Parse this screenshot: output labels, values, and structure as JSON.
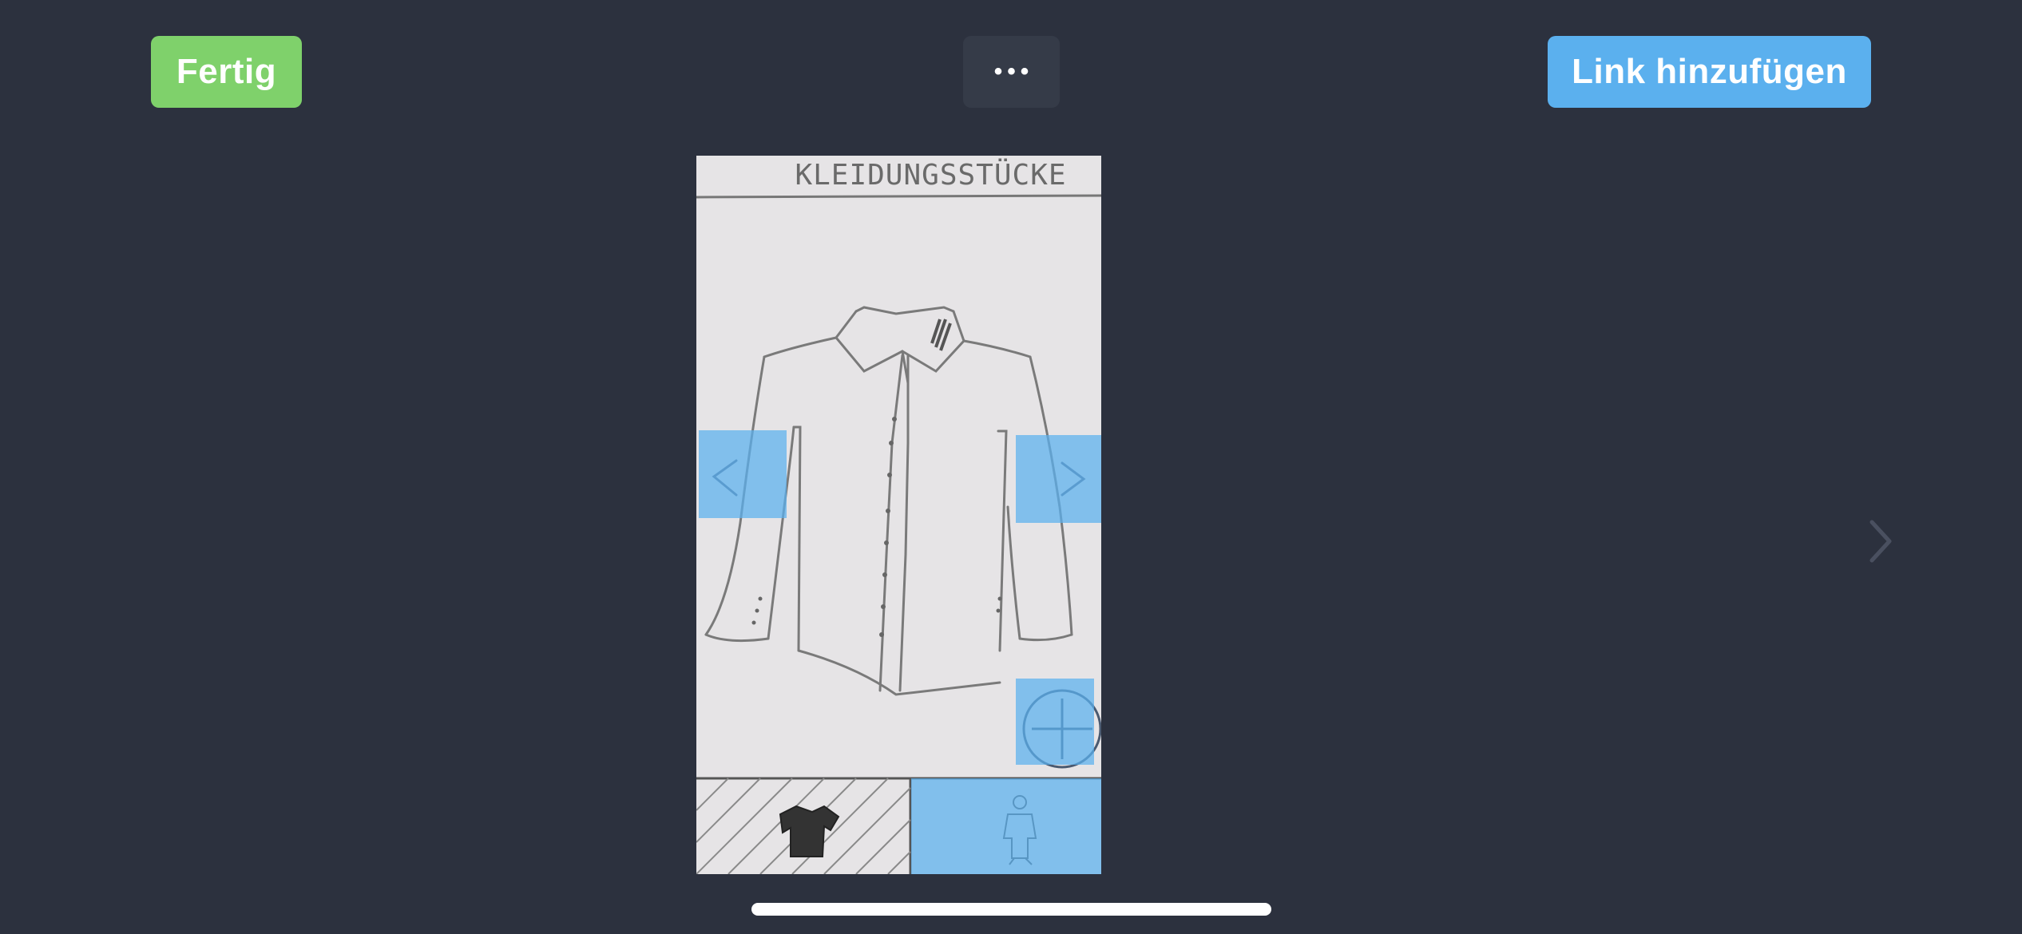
{
  "toolbar": {
    "done_label": "Fertig",
    "more_label": "•••",
    "add_link_label": "Link hinzufügen"
  },
  "sketch": {
    "title": "KLEIDUNGSSTÜCKE"
  },
  "colors": {
    "background": "#2c313e",
    "done_button": "#7fd16b",
    "more_button": "#353b48",
    "link_button": "#5bb0ee",
    "hotspot": "#5ab0ee"
  },
  "icons": {
    "prev": "chevron-left-icon",
    "next": "chevron-right-icon",
    "add": "plus-circle-icon",
    "shirt": "shirt-icon",
    "person": "person-icon",
    "next_screen": "chevron-right-icon"
  }
}
